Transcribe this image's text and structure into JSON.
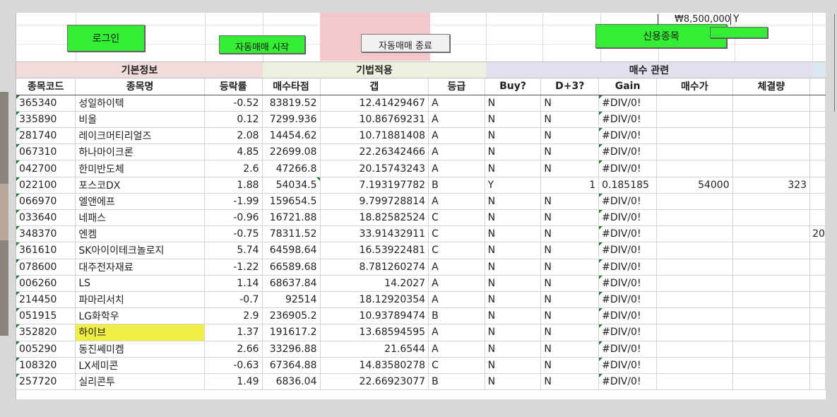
{
  "toolbar": {
    "login_label": "로그인",
    "auto_start_label": "자동매매 시작",
    "auto_stop_label": "자동매매 종료",
    "credit_label": "신용종목",
    "balance_text": "₩8,500,000",
    "balance_flag": "Y"
  },
  "groups": {
    "basic": "기본정보",
    "technique": "기법적용",
    "buy": "매수 관련"
  },
  "headers": [
    "종목코드",
    "종목명",
    "등락률",
    "매수타점",
    "갭",
    "등급",
    "Buy?",
    "D+3?",
    "Gain",
    "매수가",
    "체결량"
  ],
  "colors": {
    "button_green": "#33ee33",
    "header_basic_bg": "#f2dcdb",
    "header_technique_bg": "#ebf1de",
    "header_buy_bg": "#e4dfec",
    "highlight_yellow": "#eeee44",
    "pink_area": "#f4c7cc"
  },
  "rows": [
    {
      "code": "365340",
      "name": "성일하이텍",
      "rate": "-0.52",
      "target": "83819.52",
      "gap": "12.41429467",
      "grade": "A",
      "buy": "N",
      "d3": "N",
      "gain": "#DIV/0!",
      "price": "",
      "qty": ""
    },
    {
      "code": "335890",
      "name": "비올",
      "rate": "0.12",
      "target": "7299.936",
      "gap": "10.86769231",
      "grade": "A",
      "buy": "N",
      "d3": "N",
      "gain": "#DIV/0!",
      "price": "",
      "qty": ""
    },
    {
      "code": "281740",
      "name": "레이크머티리얼즈",
      "rate": "2.08",
      "target": "14454.62",
      "gap": "10.71881408",
      "grade": "A",
      "buy": "N",
      "d3": "N",
      "gain": "#DIV/0!",
      "price": "",
      "qty": ""
    },
    {
      "code": "067310",
      "name": "하나마이크론",
      "rate": "4.85",
      "target": "22699.08",
      "gap": "22.26342466",
      "grade": "A",
      "buy": "N",
      "d3": "N",
      "gain": "#DIV/0!",
      "price": "",
      "qty": ""
    },
    {
      "code": "042700",
      "name": "한미반도체",
      "rate": "2.6",
      "target": "47266.8",
      "gap": "20.15743243",
      "grade": "A",
      "buy": "N",
      "d3": "N",
      "gain": "#DIV/0!",
      "price": "",
      "qty": ""
    },
    {
      "code": "022100",
      "name": "포스코DX",
      "rate": "1.88",
      "target": "54034.5",
      "gap": "7.193197782",
      "grade": "B",
      "buy": "Y",
      "d3": "1",
      "gain": "0.185185",
      "price": "54000",
      "qty": "323"
    },
    {
      "code": "066970",
      "name": "엘앤에프",
      "rate": "-1.99",
      "target": "159654.5",
      "gap": "9.799728814",
      "grade": "A",
      "buy": "N",
      "d3": "N",
      "gain": "#DIV/0!",
      "price": "",
      "qty": ""
    },
    {
      "code": "033640",
      "name": "네패스",
      "rate": "-0.96",
      "target": "16721.88",
      "gap": "18.82582524",
      "grade": "C",
      "buy": "N",
      "d3": "N",
      "gain": "#DIV/0!",
      "price": "",
      "qty": ""
    },
    {
      "code": "348370",
      "name": "엔켐",
      "rate": "-0.75",
      "target": "78311.52",
      "gap": "33.91432911",
      "grade": "C",
      "buy": "N",
      "d3": "N",
      "gain": "#DIV/0!",
      "price": "",
      "qty": "",
      "extra": "20"
    },
    {
      "code": "361610",
      "name": "SK아이이테크놀로지",
      "rate": "5.74",
      "target": "64598.64",
      "gap": "16.53922481",
      "grade": "C",
      "buy": "N",
      "d3": "N",
      "gain": "#DIV/0!",
      "price": "",
      "qty": ""
    },
    {
      "code": "078600",
      "name": "대주전자재료",
      "rate": "-1.22",
      "target": "66589.68",
      "gap": "8.781260274",
      "grade": "A",
      "buy": "N",
      "d3": "N",
      "gain": "#DIV/0!",
      "price": "",
      "qty": ""
    },
    {
      "code": "006260",
      "name": "LS",
      "rate": "1.14",
      "target": "68637.84",
      "gap": "14.2027",
      "grade": "A",
      "buy": "N",
      "d3": "N",
      "gain": "#DIV/0!",
      "price": "",
      "qty": ""
    },
    {
      "code": "214450",
      "name": "파마리서치",
      "rate": "-0.7",
      "target": "92514",
      "gap": "18.12920354",
      "grade": "A",
      "buy": "N",
      "d3": "N",
      "gain": "#DIV/0!",
      "price": "",
      "qty": ""
    },
    {
      "code": "051915",
      "name": "LG화학우",
      "rate": "2.9",
      "target": "236905.2",
      "gap": "10.93789474",
      "grade": "B",
      "buy": "N",
      "d3": "N",
      "gain": "#DIV/0!",
      "price": "",
      "qty": ""
    },
    {
      "code": "352820",
      "name": "하이브",
      "rate": "1.37",
      "target": "191617.2",
      "gap": "13.68594595",
      "grade": "A",
      "buy": "N",
      "d3": "N",
      "gain": "#DIV/0!",
      "price": "",
      "qty": ""
    },
    {
      "code": "005290",
      "name": "동진쎄미켐",
      "rate": "2.66",
      "target": "33296.88",
      "gap": "21.6544",
      "grade": "A",
      "buy": "N",
      "d3": "N",
      "gain": "#DIV/0!",
      "price": "",
      "qty": ""
    },
    {
      "code": "108320",
      "name": "LX세미콘",
      "rate": "-0.63",
      "target": "67364.88",
      "gap": "14.83580278",
      "grade": "C",
      "buy": "N",
      "d3": "N",
      "gain": "#DIV/0!",
      "price": "",
      "qty": ""
    },
    {
      "code": "257720",
      "name": "실리콘투",
      "rate": "1.49",
      "target": "6836.04",
      "gap": "22.66923077",
      "grade": "B",
      "buy": "N",
      "d3": "N",
      "gain": "#DIV/0!",
      "price": "",
      "qty": ""
    }
  ]
}
